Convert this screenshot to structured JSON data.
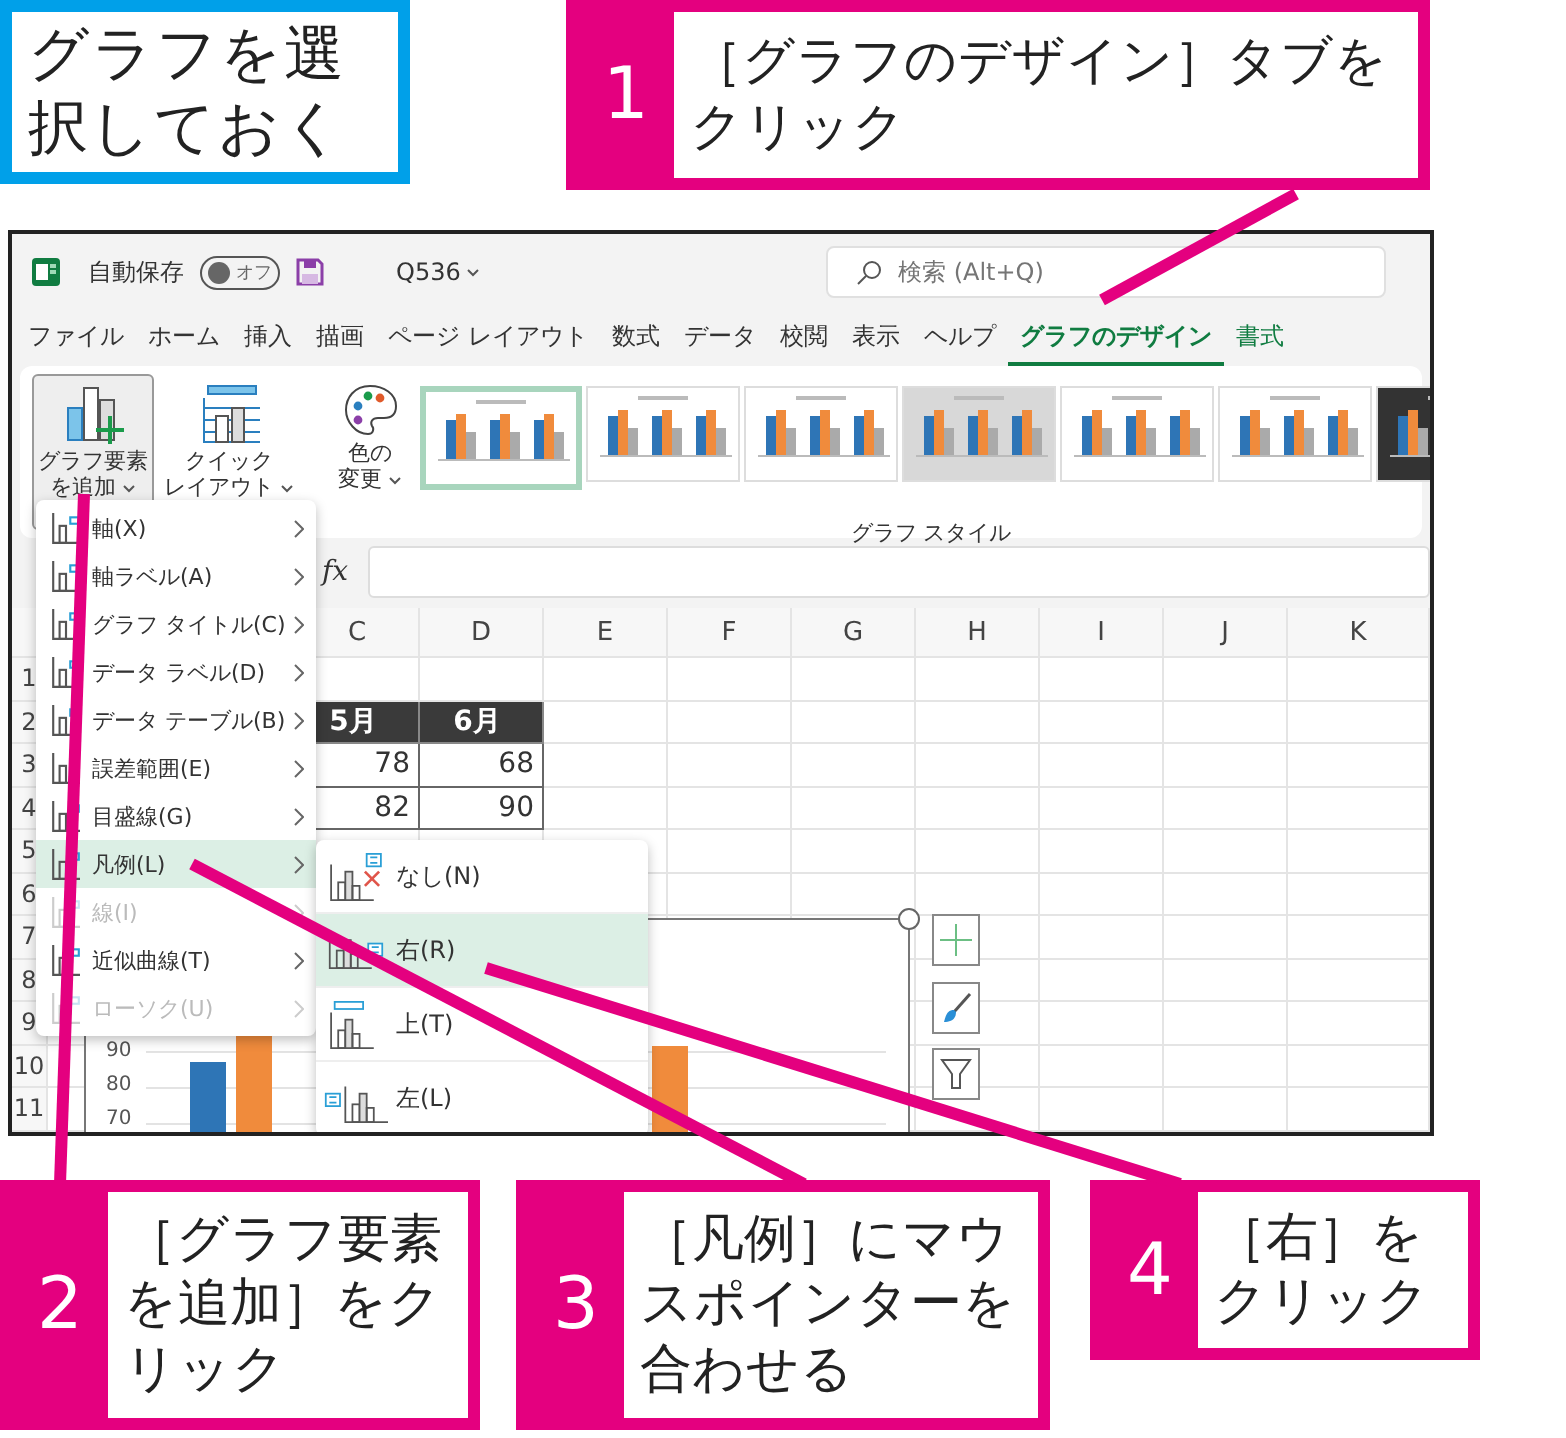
{
  "callouts_top": [
    {
      "kind": "note",
      "text": "グラフを選択しておく"
    },
    {
      "kind": "step",
      "number": "1",
      "text": "［グラフのデザイン］タブをクリック"
    }
  ],
  "excel": {
    "title_bar": {
      "autosave_label": "自動保存",
      "autosave_toggle": {
        "label": "オフ",
        "on": false
      },
      "file_name": "Q536",
      "search": {
        "placeholder": "検索 (Alt+Q)"
      }
    },
    "tabs": [
      {
        "label": "ファイル",
        "selected": false,
        "contextual": false
      },
      {
        "label": "ホーム",
        "selected": false,
        "contextual": false
      },
      {
        "label": "挿入",
        "selected": false,
        "contextual": false
      },
      {
        "label": "描画",
        "selected": false,
        "contextual": false
      },
      {
        "label": "ページ レイアウト",
        "selected": false,
        "contextual": false
      },
      {
        "label": "数式",
        "selected": false,
        "contextual": false
      },
      {
        "label": "データ",
        "selected": false,
        "contextual": false
      },
      {
        "label": "校閲",
        "selected": false,
        "contextual": false
      },
      {
        "label": "表示",
        "selected": false,
        "contextual": false
      },
      {
        "label": "ヘルプ",
        "selected": false,
        "contextual": false
      },
      {
        "label": "グラフのデザイン",
        "selected": true,
        "contextual": true
      },
      {
        "label": "書式",
        "selected": false,
        "contextual": true
      }
    ],
    "ribbon": {
      "buttons": [
        {
          "kind": "add-element",
          "lines": [
            "グラフ要素",
            "を追加"
          ],
          "pressed": true
        },
        {
          "kind": "quick-layout",
          "lines": [
            "クイック",
            "レイアウト"
          ],
          "pressed": false
        },
        {
          "kind": "colors",
          "lines": [
            "色の",
            "変更"
          ],
          "pressed": false
        }
      ],
      "chart_styles": [
        {
          "selected": true
        },
        {
          "selected": false
        },
        {
          "selected": false
        },
        {
          "selected": false
        },
        {
          "selected": false
        },
        {
          "selected": false
        },
        {
          "selected": false
        }
      ],
      "group_label": "グラフ スタイル"
    },
    "formula_bar": {
      "function_label": "fx"
    },
    "columns": [
      "C",
      "D",
      "E",
      "F",
      "G",
      "H",
      "I",
      "J",
      "K"
    ],
    "row_numbers": [
      "1",
      "2",
      "3",
      "4",
      "5",
      "6",
      "7",
      "8",
      "9",
      "10",
      "11"
    ],
    "table": {
      "header": [
        "5月",
        "6月"
      ],
      "rows": [
        [
          "78",
          "68"
        ],
        [
          "82",
          "90"
        ]
      ]
    },
    "chart": {
      "axis_labels": [
        "90",
        "80",
        "70"
      ]
    },
    "menu": {
      "items": [
        {
          "label": "軸(X)",
          "selected": false,
          "disabled": false
        },
        {
          "label": "軸ラベル(A)",
          "selected": false,
          "disabled": false
        },
        {
          "label": "グラフ タイトル(C)",
          "selected": false,
          "disabled": false
        },
        {
          "label": "データ ラベル(D)",
          "selected": false,
          "disabled": false
        },
        {
          "label": "データ テーブル(B)",
          "selected": false,
          "disabled": false
        },
        {
          "label": "誤差範囲(E)",
          "selected": false,
          "disabled": false
        },
        {
          "label": "目盛線(G)",
          "selected": false,
          "disabled": false
        },
        {
          "label": "凡例(L)",
          "selected": true,
          "disabled": false
        },
        {
          "label": "線(I)",
          "selected": false,
          "disabled": true
        },
        {
          "label": "近似曲線(T)",
          "selected": false,
          "disabled": false
        },
        {
          "label": "ローソク(U)",
          "selected": false,
          "disabled": true
        }
      ]
    },
    "submenu": {
      "items": [
        {
          "kind": "none",
          "label": "なし(N)",
          "selected": false
        },
        {
          "kind": "right",
          "label": "右(R)",
          "selected": true
        },
        {
          "kind": "top",
          "label": "上(T)",
          "selected": false
        },
        {
          "kind": "left",
          "label": "左(L)",
          "selected": false
        }
      ]
    }
  },
  "callouts_bottom": [
    {
      "kind": "step",
      "number": "2",
      "text": "［グラフ要素を追加］をクリック"
    },
    {
      "kind": "step",
      "number": "3",
      "text": "［凡例］にマウスポインターを合わせる"
    },
    {
      "kind": "step",
      "number": "4",
      "text": "［右］をクリック"
    }
  ]
}
